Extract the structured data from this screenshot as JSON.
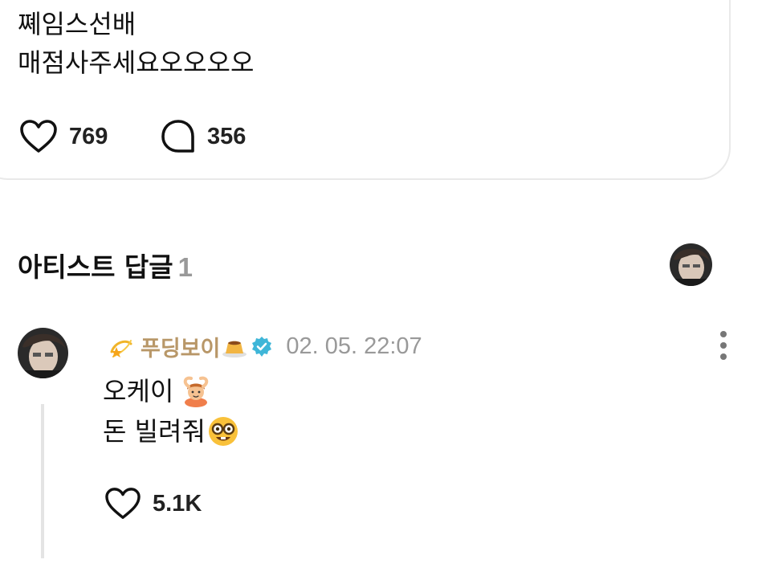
{
  "post": {
    "lines": [
      "쪠임스선배",
      "매점사주세요오오오오"
    ],
    "likes": "769",
    "comments": "356"
  },
  "artist_replies": {
    "title": "아티스트 답글",
    "count": "1"
  },
  "reply": {
    "username": "푸딩보이",
    "timestamp": "02. 05. 22:07",
    "lines": [
      "오케이",
      "돈 빌려줘"
    ],
    "likes": "5.1K",
    "icons": [
      "dizzy-icon",
      "pudding-icon",
      "verified-badge-icon",
      "person-gesturing-ok-icon",
      "nerd-face-icon"
    ]
  },
  "colors": {
    "username": "#b89768",
    "verified": "#3fb6d8",
    "muted": "#999999"
  }
}
